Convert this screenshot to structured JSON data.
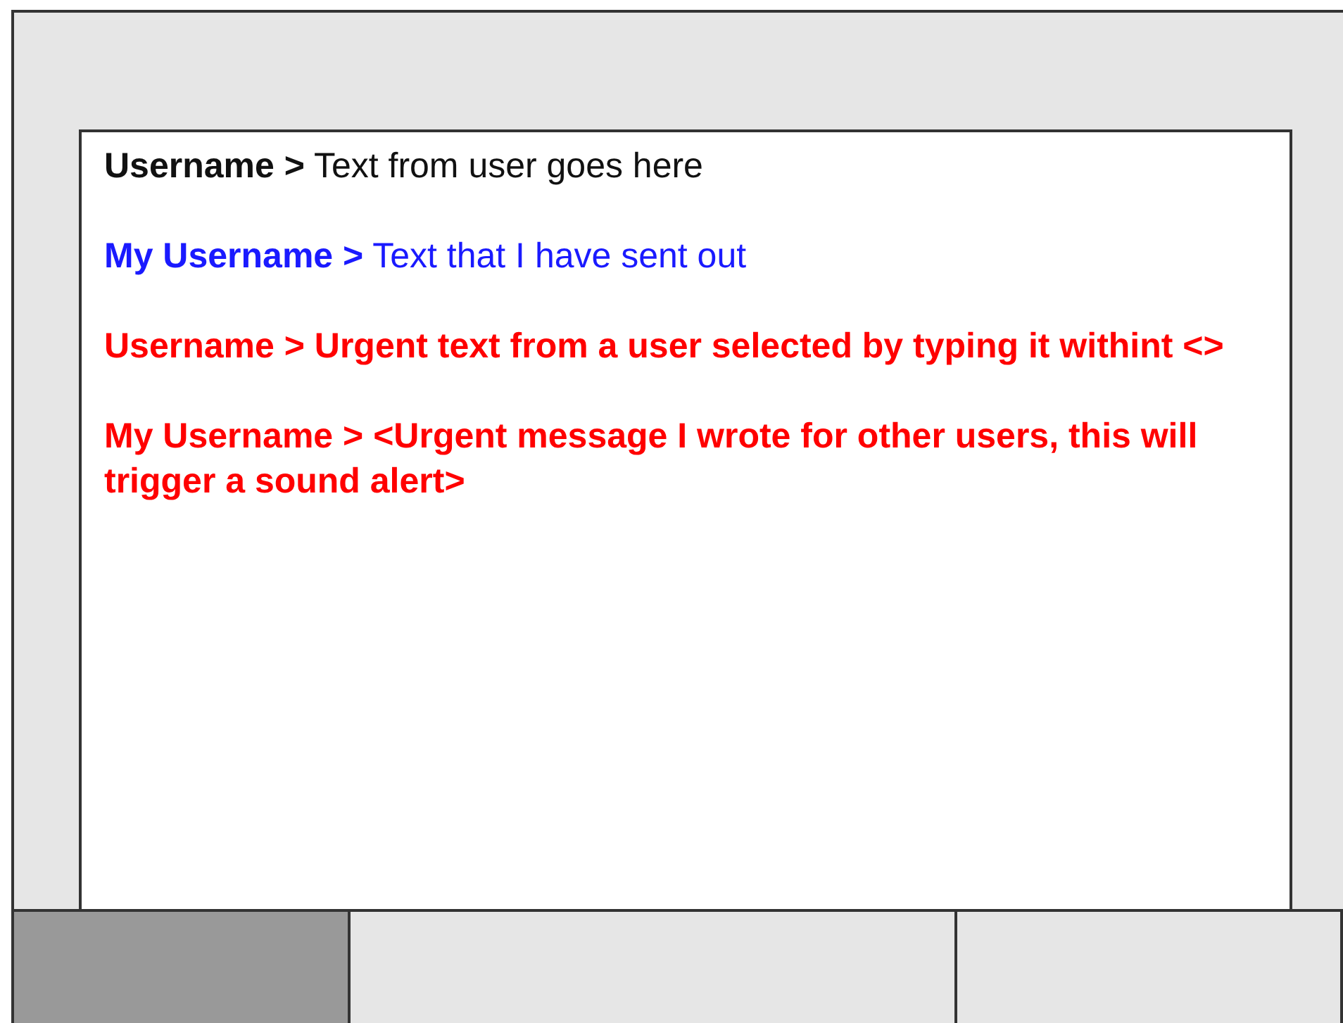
{
  "messages": [
    {
      "kind": "normal",
      "sender": "Username >",
      "text": "Text from user goes here"
    },
    {
      "kind": "own",
      "sender": "My Username >",
      "text": "Text that I have sent out"
    },
    {
      "kind": "urgent",
      "sender": "Username >",
      "text": "Urgent text from a user selected by typing it withint <>"
    },
    {
      "kind": "urgent",
      "sender": "My Username >",
      "text": "<Urgent message I wrote for other users, this will trigger a sound alert>"
    }
  ],
  "bottom_panels": [
    {
      "selected": true
    },
    {
      "selected": false
    },
    {
      "selected": false
    }
  ]
}
